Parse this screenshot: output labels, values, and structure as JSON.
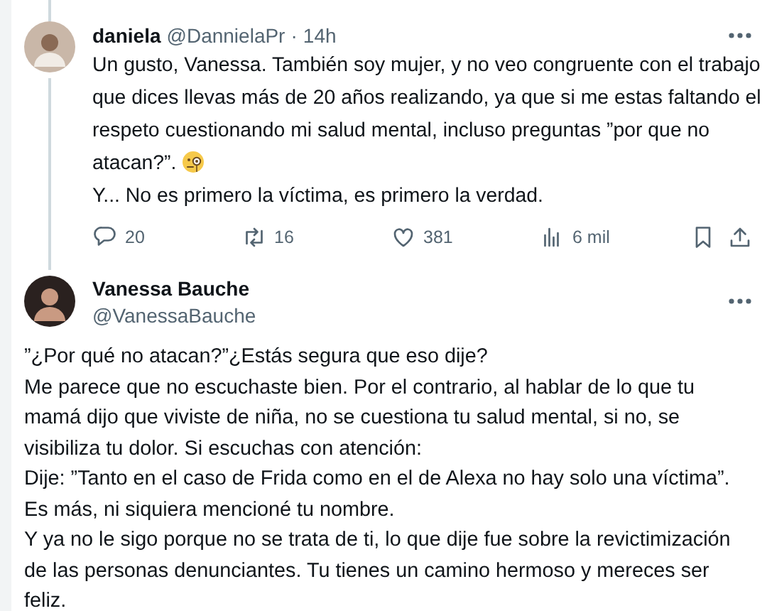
{
  "tweets": [
    {
      "kind": "reply",
      "name": "daniela",
      "handle": "@DannielaPr",
      "separator": "·",
      "time": "14h",
      "paragraphs": [
        {
          "text": "Un gusto, Vanessa. También soy mujer, y no veo congruente con el trabajo que dices llevas más de 20 años realizando, ya que si me estas faltando el respeto cuestionando mi salud mental, incluso preguntas ”por que no atacan?”.",
          "emoji": true
        },
        {
          "text": "Y... No es primero la víctima, es primero la verdad."
        }
      ],
      "actions": {
        "replies": "20",
        "reposts": "16",
        "likes": "381",
        "views": "6 mil"
      }
    },
    {
      "kind": "focused",
      "name": "Vanessa Bauche",
      "handle": "@VanessaBauche",
      "paragraphs": [
        {
          "text": "”¿Por qué no atacan?”¿Estás segura que eso dije?"
        },
        {
          "text": "Me parece que no escuchaste bien. Por el contrario, al hablar de lo que tu mamá dijo que viviste de niña, no se cuestiona tu salud mental, si no, se visibiliza tu dolor. Si escuchas con atención:"
        },
        {
          "text": "Dije: ”Tanto en el caso de Frida como en el de Alexa no hay solo una víctima”. Es más, ni siquiera mencioné tu nombre."
        },
        {
          "text": "Y ya no le sigo porque no se trata de ti, lo que dije fue sobre la revictimización de las personas denunciantes. Tu tienes un camino hermoso y mereces ser feliz."
        }
      ]
    }
  ]
}
